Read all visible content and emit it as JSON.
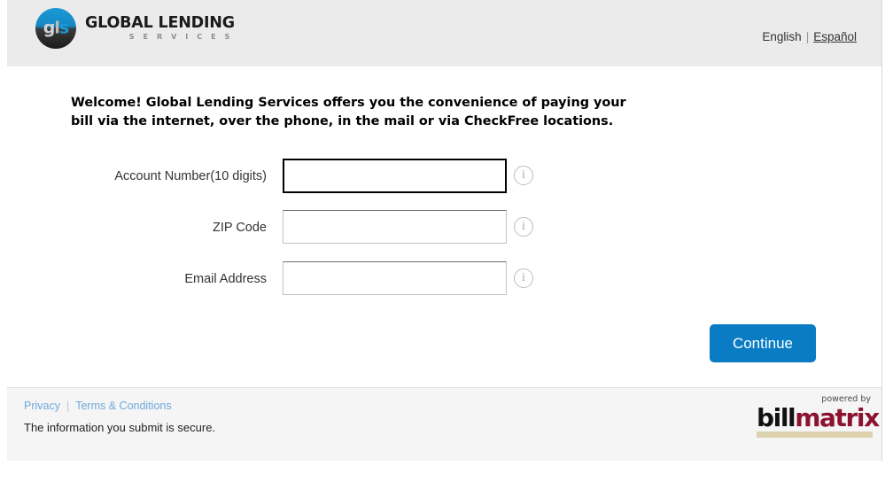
{
  "header": {
    "logo": {
      "mark_text": "gls",
      "title": "GLOBAL LENDING",
      "subtitle": "S E R V I C E S"
    },
    "language": {
      "english_label": "English",
      "separator": "|",
      "spanish_label": "Español"
    }
  },
  "main": {
    "welcome_text": "Welcome! Global Lending Services offers you the convenience of paying your bill via the internet, over the phone, in the mail or via CheckFree locations.",
    "fields": [
      {
        "label": "Account Number(10 digits)",
        "value": "",
        "placeholder": "",
        "info_icon": "info-icon",
        "focused": true
      },
      {
        "label": "ZIP Code",
        "value": "",
        "placeholder": "",
        "info_icon": "info-icon",
        "focused": false
      },
      {
        "label": "Email Address",
        "value": "",
        "placeholder": "",
        "info_icon": "info-icon",
        "focused": false
      }
    ],
    "continue_label": "Continue",
    "continue_color": "#0a7cc4"
  },
  "footer": {
    "privacy_label": "Privacy",
    "separator": "|",
    "terms_label": "Terms & Conditions",
    "secure_text": "The information you submit is secure.",
    "link_color": "#6fa8dc",
    "billmatrix": {
      "powered_by": "powered by",
      "bill": "bill",
      "matrix": "matrix",
      "bill_color": "#111111",
      "matrix_color": "#8c1330",
      "bar_color": "#ddd3ae"
    }
  }
}
